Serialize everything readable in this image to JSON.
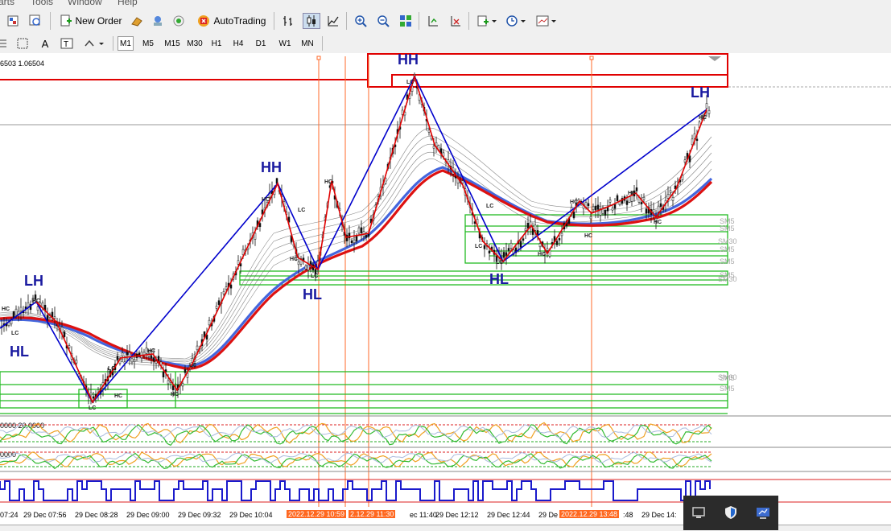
{
  "menu": {
    "items": [
      "arts",
      "Tools",
      "Window",
      "Help"
    ]
  },
  "toolbar": {
    "new_order_label": "New Order",
    "autotrading_label": "AutoTrading"
  },
  "timeframes": [
    "M1",
    "M5",
    "M15",
    "M30",
    "H1",
    "H4",
    "D1",
    "W1",
    "MN"
  ],
  "active_timeframe": "M1",
  "chart": {
    "price_info": "6503 1.06504",
    "labels": {
      "hh_top": "HH",
      "hh_left": "HH",
      "lh_right": "LH",
      "lh_left": "LH",
      "hl_left": "HL",
      "hl_mid": "HL",
      "hl_right": "HL"
    },
    "zone_labels": [
      "SM5",
      "SM5",
      "SM30",
      "SM5",
      "SM5",
      "SM5",
      "SM30",
      "SM5",
      "SM30",
      "SM5"
    ],
    "osc1_label": "0000 20.0000",
    "osc2_label": "0000",
    "colors": {
      "bull_line": "#0000cc",
      "bear_line": "#e00000",
      "zone": "#22bb22",
      "ma_blue": "#4466dd",
      "ma_red": "#dd1111"
    }
  },
  "time_axis": {
    "labels": [
      "07:24",
      "29 Dec 07:56",
      "29 Dec 08:28",
      "29 Dec 09:00",
      "29 Dec 09:32",
      "29 Dec 10:04"
    ],
    "highlight_1": "2022.12.29 10:59",
    "highlight_2": "2.12.29 11:30",
    "mid_label": "ec 11:40",
    "labels_b": [
      "29 Dec 12:12",
      "29 Dec 12:44"
    ],
    "prefix_c": "29 De",
    "highlight_3": "2022.12.29 13:48",
    "label_d": ":48",
    "label_e": "29 Dec 14:"
  }
}
